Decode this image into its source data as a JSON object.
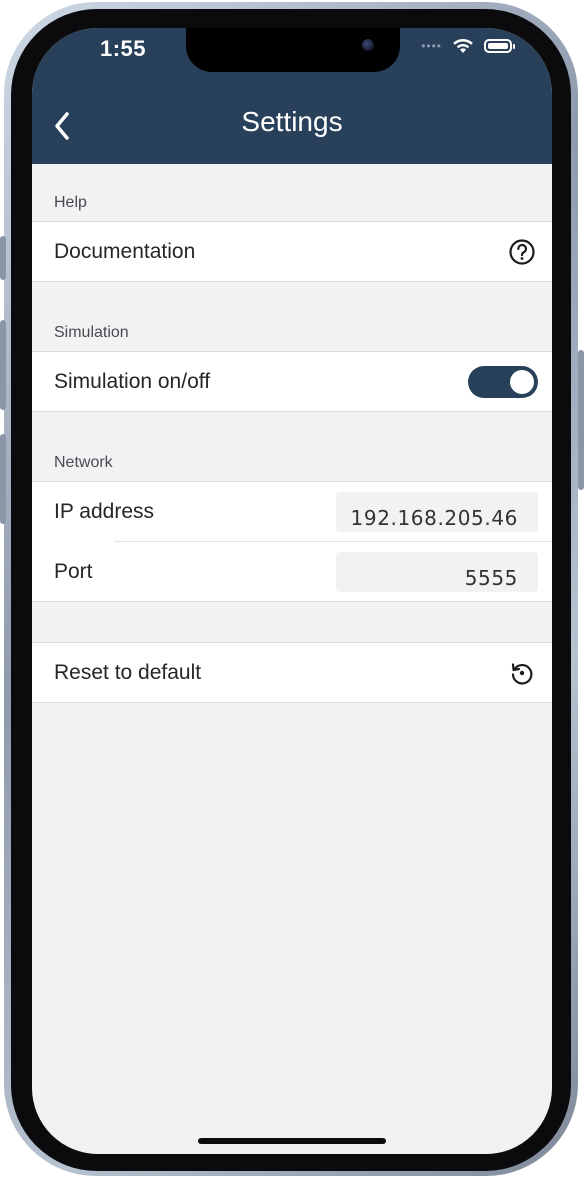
{
  "status_bar": {
    "time": "1:55"
  },
  "nav": {
    "title": "Settings"
  },
  "sections": {
    "help": {
      "header": "Help",
      "documentation_label": "Documentation",
      "documentation_icon": "question-circle-icon"
    },
    "simulation": {
      "header": "Simulation",
      "toggle_label": "Simulation on/off",
      "toggle_on": true
    },
    "network": {
      "header": "Network",
      "ip_label": "IP address",
      "ip_value": "192.168.205.46",
      "port_label": "Port",
      "port_value": "5555"
    },
    "reset": {
      "label": "Reset to default",
      "icon": "reset-icon"
    }
  },
  "colors": {
    "header_bg": "#284059",
    "toggle_on": "#284059",
    "background": "#f2f2f4"
  }
}
